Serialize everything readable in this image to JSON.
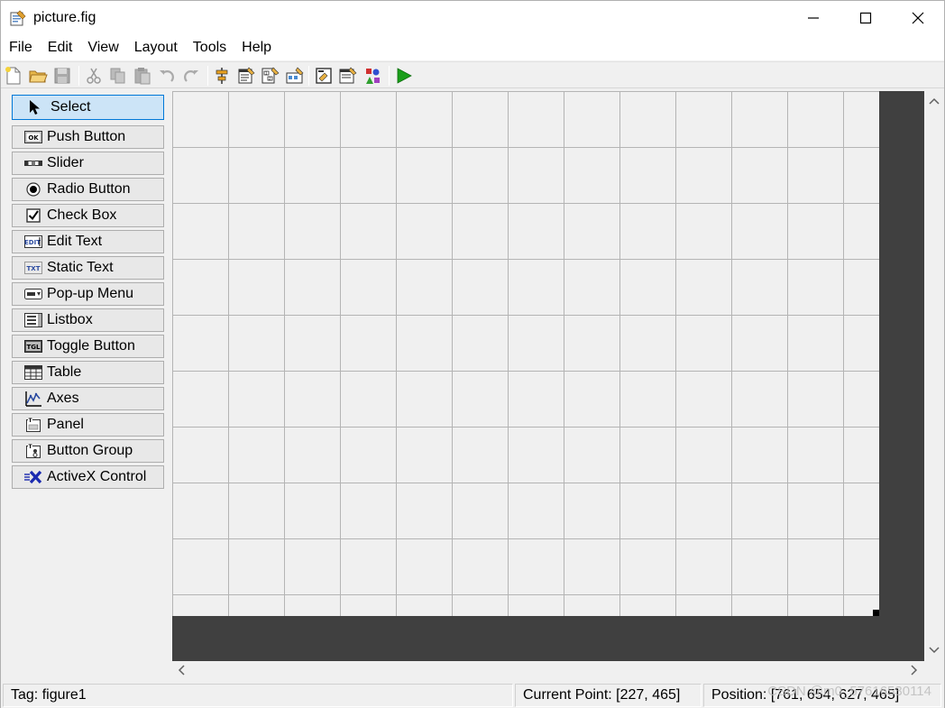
{
  "window": {
    "title": "picture.fig",
    "controls": {
      "minimize": "minimize",
      "maximize": "maximize",
      "close": "close"
    }
  },
  "menu": [
    "File",
    "Edit",
    "View",
    "Layout",
    "Tools",
    "Help"
  ],
  "toolbar": {
    "icons": [
      "new-file-icon",
      "open-folder-icon",
      "save-icon",
      "cut-icon",
      "copy-icon",
      "paste-icon",
      "undo-icon",
      "redo-icon",
      "align-icon",
      "menu-editor-icon",
      "tab-order-icon",
      "toolbar-editor-icon",
      "editor-icon",
      "property-inspector-icon",
      "object-browser-icon",
      "run-icon"
    ]
  },
  "palette": {
    "items": [
      {
        "label": "Select",
        "icon": "cursor-icon",
        "selected": true
      },
      {
        "label": "Push Button",
        "icon": "push-button-icon"
      },
      {
        "label": "Slider",
        "icon": "slider-icon"
      },
      {
        "label": "Radio Button",
        "icon": "radio-button-icon"
      },
      {
        "label": "Check Box",
        "icon": "check-box-icon"
      },
      {
        "label": "Edit Text",
        "icon": "edit-text-icon"
      },
      {
        "label": "Static Text",
        "icon": "static-text-icon"
      },
      {
        "label": "Pop-up Menu",
        "icon": "popup-menu-icon"
      },
      {
        "label": "Listbox",
        "icon": "listbox-icon"
      },
      {
        "label": "Toggle Button",
        "icon": "toggle-button-icon"
      },
      {
        "label": "Table",
        "icon": "table-icon"
      },
      {
        "label": "Axes",
        "icon": "axes-icon"
      },
      {
        "label": "Panel",
        "icon": "panel-icon"
      },
      {
        "label": "Button Group",
        "icon": "button-group-icon"
      },
      {
        "label": "ActiveX Control",
        "icon": "activex-icon"
      }
    ],
    "icon_text": {
      "push": "OK",
      "edit": "EDIT",
      "static": "TXT",
      "toggle": "TGL"
    }
  },
  "status": {
    "tag": "Tag: figure1",
    "current_point": "Current Point:  [227, 465]",
    "position": "Position: [761, 654, 627, 465]"
  },
  "watermark": "CSDN @m0_57616530114",
  "colors": {
    "selected_bg": "#cce4f7",
    "selected_border": "#0078d7",
    "canvas_dark": "#404040",
    "grid_bg": "#f0f0f0",
    "run_green": "#1a9e1a"
  }
}
